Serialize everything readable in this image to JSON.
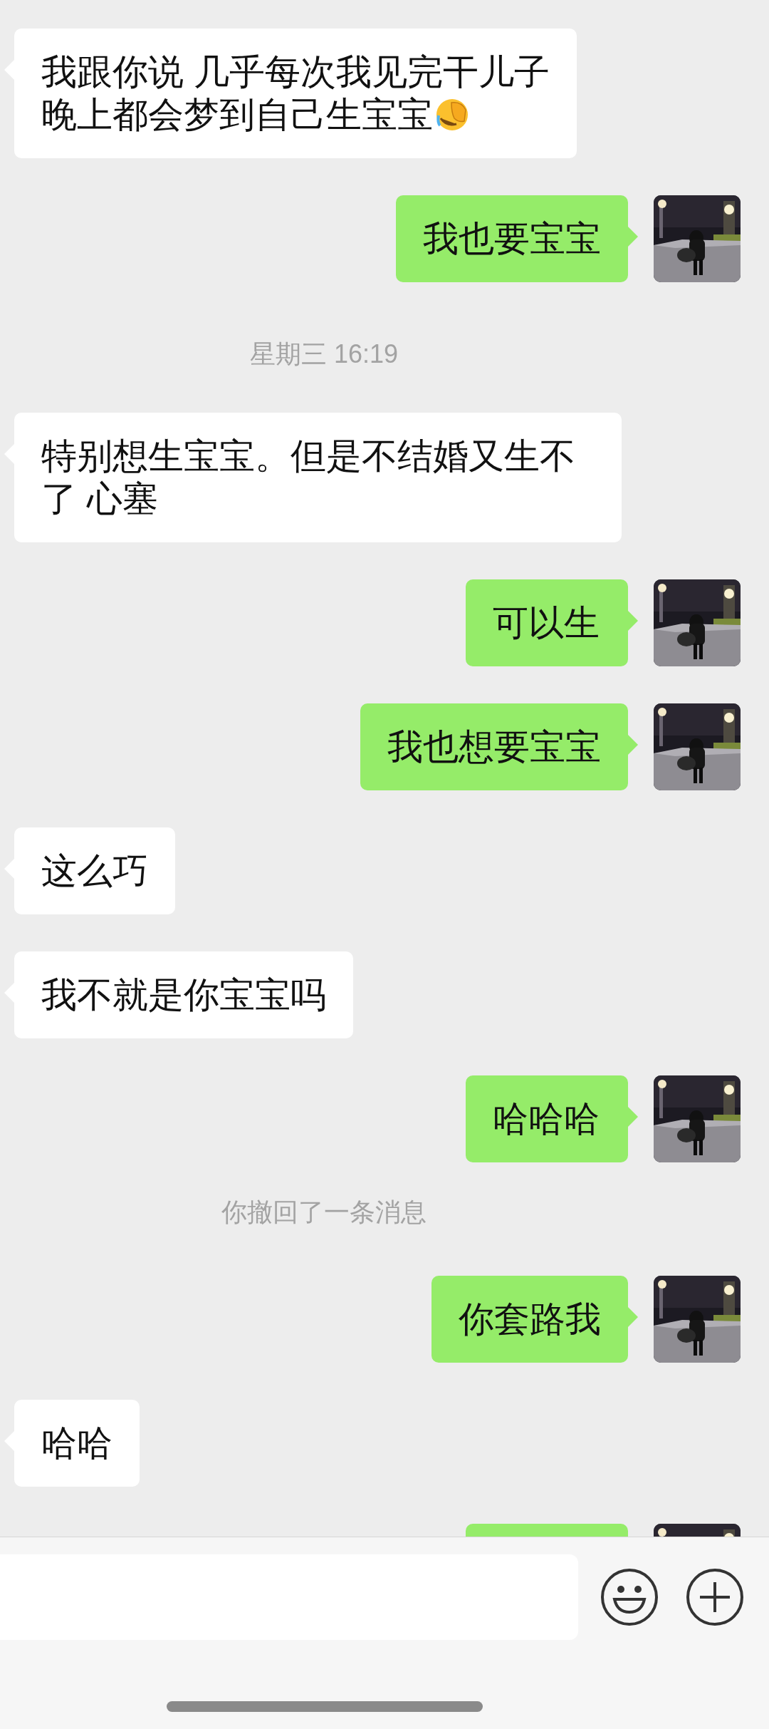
{
  "messages": [
    {
      "kind": "received",
      "lines": [
        "我跟你说 几乎每次我见完干儿子",
        "晚上都会梦到自己生宝宝"
      ],
      "trailing_emoji": true
    },
    {
      "kind": "sent",
      "text": "我也要宝宝"
    },
    {
      "kind": "time",
      "text": "星期三 16:19"
    },
    {
      "kind": "received",
      "text": "特别想生宝宝。但是不结婚又生不了 心塞"
    },
    {
      "kind": "sent",
      "text": "可以生"
    },
    {
      "kind": "sent",
      "text": "我也想要宝宝"
    },
    {
      "kind": "received",
      "text": "这么巧"
    },
    {
      "kind": "received",
      "text": "我不就是你宝宝吗"
    },
    {
      "kind": "sent",
      "text": "哈哈哈"
    },
    {
      "kind": "notice",
      "text": "你撤回了一条消息"
    },
    {
      "kind": "sent",
      "text": "你套路我"
    },
    {
      "kind": "received",
      "text": "哈哈"
    },
    {
      "kind": "sent"
    }
  ]
}
